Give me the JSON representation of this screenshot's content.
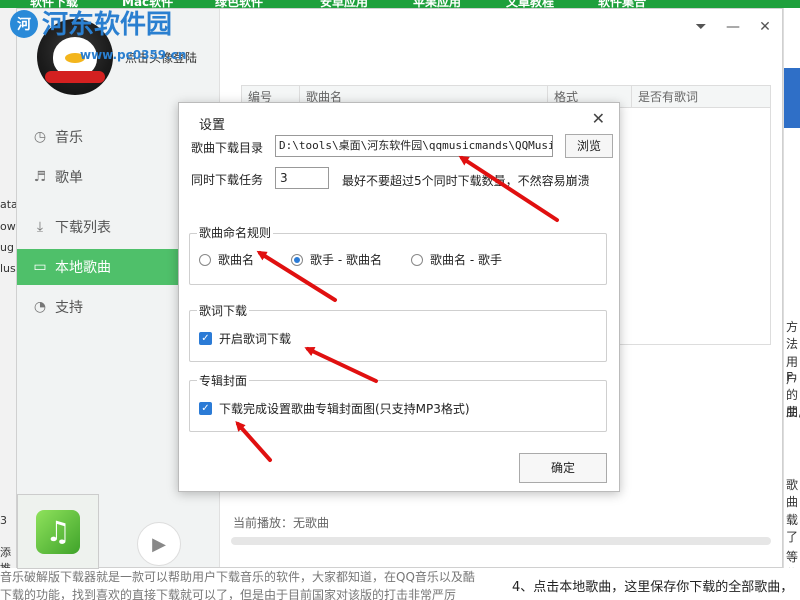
{
  "watermark": {
    "logo_letter": "河",
    "text": "河东软件园",
    "url": "www.pc0359.cn"
  },
  "top_nav": [
    "软件下载",
    "Mac软件",
    "绿色软件",
    "安卓应用",
    "苹果应用",
    "文章教程",
    "软件集合"
  ],
  "bg_left_fragments": [
    "ata",
    "ow",
    "ug",
    "lus",
    "3",
    "添推"
  ],
  "bg_right_fragments": [
    "方法",
    "用户",
    "F,",
    "的朋",
    "曲,",
    "歌曲",
    "载了",
    "等信"
  ],
  "bg_bottom": {
    "line1": "音乐破解版下载器就是一款可以帮助用户下载音乐的软件，大家都知道，在QQ音乐以及酷",
    "line2": "下载的功能，找到喜欢的直接下载就可以了，但是由于目前国家对该版的打击非常严厉",
    "line3": "4、点击本地歌曲，这里保存你下载的全部歌曲，"
  },
  "app": {
    "login_text": "点击头像登陆",
    "nav": [
      {
        "label": "音乐",
        "icon": "music-icon",
        "glyph": "◷",
        "active": false
      },
      {
        "label": "歌单",
        "icon": "playlist-icon",
        "glyph": "♬",
        "active": false
      },
      {
        "label": "下载列表",
        "icon": "download-icon",
        "glyph": "⤓",
        "active": false
      },
      {
        "label": "本地歌曲",
        "icon": "monitor-icon",
        "glyph": "▭",
        "active": true
      },
      {
        "label": "支持",
        "icon": "support-icon",
        "glyph": "◔",
        "active": false
      }
    ],
    "table_headers": [
      "编号",
      "歌曲名",
      "格式",
      "是否有歌词"
    ],
    "now_playing": "当前播放：无歌曲",
    "window_controls": {
      "menu": "⏷",
      "minimize": "—",
      "close": "✕"
    }
  },
  "dialog": {
    "title": "设置",
    "download_dir_label": "歌曲下载目录",
    "download_dir_value": "D:\\tools\\桌面\\河东软件园\\qqmusicmands\\QQMusicI",
    "browse_label": "浏览",
    "concurrent_label": "同时下载任务",
    "concurrent_value": "3",
    "concurrent_hint": "最好不要超过5个同时下载数量，不然容易崩溃",
    "naming_group": {
      "title": "歌曲命名规则",
      "options": [
        {
          "label": "歌曲名",
          "selected": false
        },
        {
          "label": "歌手 - 歌曲名",
          "selected": true
        },
        {
          "label": "歌曲名 - 歌手",
          "selected": false
        }
      ]
    },
    "lyrics_group": {
      "title": "歌词下载",
      "checkbox_label": "开启歌词下载",
      "checked": true
    },
    "cover_group": {
      "title": "专辑封面",
      "checkbox_label": "下载完成设置歌曲专辑封面图(只支持MP3格式)",
      "checked": true
    },
    "ok_label": "确定"
  },
  "colors": {
    "accent_green": "#4fc06a",
    "check_blue": "#2b7bd6",
    "arrow_red": "#e01010",
    "watermark_blue": "#2a7fd0"
  }
}
